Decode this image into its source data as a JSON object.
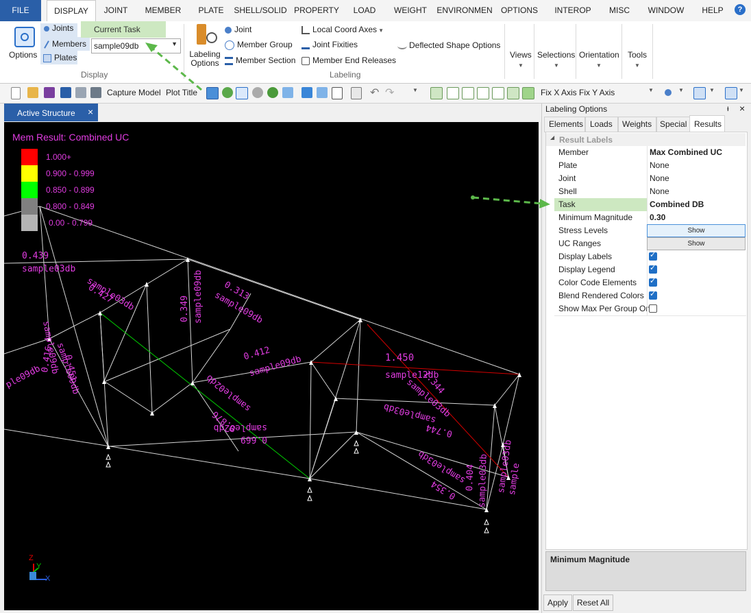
{
  "menu": {
    "items": [
      "FILE",
      "DISPLAY",
      "JOINT",
      "MEMBER",
      "PLATE",
      "SHELL/SOLID",
      "PROPERTY",
      "LOAD",
      "WEIGHT",
      "ENVIRONMEN",
      "OPTIONS",
      "INTEROP",
      "MISC",
      "WINDOW",
      "HELP"
    ],
    "help_icon": "?"
  },
  "ribbon": {
    "options_label": "Options",
    "joints": "Joints",
    "members": "Members",
    "plates": "Plates",
    "current_task_label": "Current Task",
    "current_task_value": "sample09db",
    "display_group": "Display",
    "labeling_options": "Labeling Options",
    "joint": "Joint",
    "member_group": "Member Group",
    "member_section": "Member Section",
    "local_coord_axes": "Local Coord Axes",
    "joint_fixities": "Joint Fixities",
    "member_end_releases": "Member End Releases",
    "deflected_shape_options": "Deflected Shape Options",
    "labeling_group": "Labeling",
    "views": "Views",
    "selections": "Selections",
    "orientation": "Orientation",
    "tools": "Tools"
  },
  "toolbar": {
    "capture_model": "Capture Model",
    "plot_title": "Plot Title",
    "fix_x_axis": "Fix X Axis",
    "fix_y_axis": "Fix Y Axis"
  },
  "tab": {
    "label": "Active Structure",
    "close": "×"
  },
  "viewport": {
    "legend_title": "Mem Result: Combined UC",
    "legend": [
      {
        "range": "1.000+",
        "color": "#ff0000"
      },
      {
        "range": "0.900 - 0.999",
        "color": "#ffff00"
      },
      {
        "range": "0.850 - 0.899",
        "color": "#00ff00"
      },
      {
        "range": "0.800 - 0.849",
        "color": "#808080"
      },
      {
        "range": "0.00 - 0.799",
        "color": "#b4b4b4"
      }
    ],
    "labels": {
      "v0439": "0.439",
      "d0439": "sample03db",
      "v0427": "0.427",
      "d0427": "sample03db",
      "v0349": "0.349",
      "d0349": "sample09db",
      "v0313": "0.313",
      "d0313": "sample09db",
      "v0416": "0.416",
      "d0416": "sample09db",
      "d_left": "ple09db",
      "v0451": "0.451",
      "d0451": "sample09db",
      "v0412": "0.412",
      "d0412": "sample09db",
      "v1450": "1.450",
      "d1450": "sample12db",
      "v1344": "1.344",
      "d1344": "sample03db",
      "v0876": "0.876",
      "d0876": "sample02db",
      "v0669": "0.669",
      "d0669": "sample02db",
      "v0744": "0.744",
      "d0744": "sample03db",
      "v0354": "0.354",
      "d0354": "sample03db",
      "v0404": "0.404",
      "d0404": "sample03db",
      "d_r1": "sample03db",
      "d_r2": "sample"
    },
    "axis": {
      "z": "Z",
      "y": "Y",
      "x": "X"
    }
  },
  "panel": {
    "title": "Labeling Options",
    "tabs": [
      "Elements",
      "Loads",
      "Weights",
      "Special",
      "Results"
    ],
    "section": "Result Labels",
    "rows": [
      {
        "name": "Member",
        "value": "Max Combined UC"
      },
      {
        "name": "Plate",
        "value": "None"
      },
      {
        "name": "Joint",
        "value": "None"
      },
      {
        "name": "Shell",
        "value": "None"
      },
      {
        "name": "Task",
        "value": "Combined DB"
      },
      {
        "name": "Minimum Magnitude",
        "value": "0.30"
      },
      {
        "name": "Stress Levels",
        "value": "Show"
      },
      {
        "name": "UC Ranges",
        "value": "Show"
      },
      {
        "name": "Display Labels",
        "value": true
      },
      {
        "name": "Display Legend",
        "value": true
      },
      {
        "name": "Color Code Elements",
        "value": true
      },
      {
        "name": "Blend Rendered Colors",
        "value": true
      },
      {
        "name": "Show Max Per Group On",
        "value": false
      }
    ],
    "description_title": "Minimum Magnitude",
    "apply": "Apply",
    "reset_all": "Reset All",
    "pin": "ᵼ",
    "close": "×"
  },
  "colors": {
    "accent": "#2a5fa8",
    "highlight_green": "#cde8c1",
    "label_magenta": "#e03ce0",
    "arrow_green": "#5cb84a"
  }
}
